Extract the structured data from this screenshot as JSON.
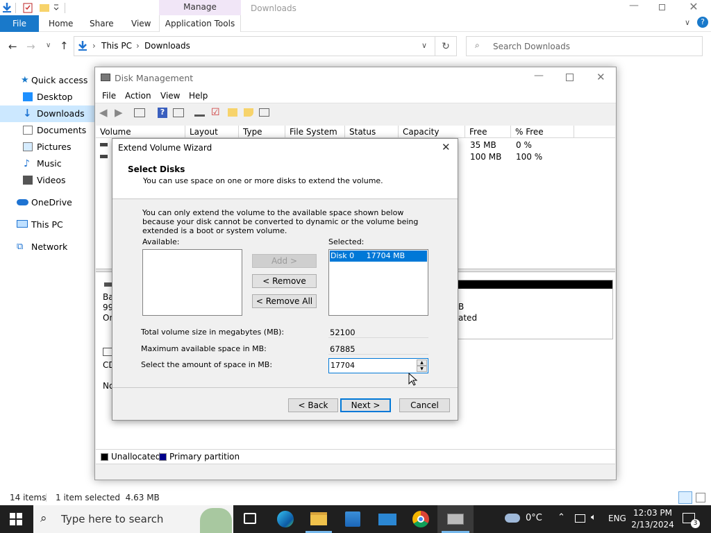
{
  "explorer": {
    "title_tab_manage": "Manage",
    "title_tab_downloads": "Downloads",
    "ribbon_tabs": [
      "File",
      "Home",
      "Share",
      "View",
      "Application Tools"
    ],
    "breadcrumb": [
      "This PC",
      "Downloads"
    ],
    "search_placeholder": "Search Downloads",
    "nav": [
      "Quick access",
      "Desktop",
      "Downloads",
      "Documents",
      "Pictures",
      "Music",
      "Videos",
      "OneDrive",
      "This PC",
      "Network"
    ],
    "status_items": "14 items",
    "status_selected": "1 item selected  4.63 MB"
  },
  "disk_mgmt": {
    "title": "Disk Management",
    "menu": [
      "File",
      "Action",
      "View",
      "Help"
    ],
    "columns": [
      "Volume",
      "Layout",
      "Type",
      "File System",
      "Status",
      "Capacity",
      "Free Spa...",
      "% Free"
    ],
    "rows": [
      {
        "free": "35 MB",
        "pct": "0 %"
      },
      {
        "free": "100 MB",
        "pct": "100 %"
      }
    ],
    "lower_left": [
      "Ba",
      "99.",
      "On",
      "CD",
      "No"
    ],
    "lower_right": [
      "B",
      "ated"
    ],
    "legend": [
      "Unallocated",
      "Primary partition"
    ],
    "legend_colors": [
      "#000000",
      "#00008b"
    ]
  },
  "wizard": {
    "title": "Extend Volume Wizard",
    "heading": "Select Disks",
    "subheading": "You can use space on one or more disks to extend the volume.",
    "notice": "You can only extend the volume to the available space shown below because your disk cannot be converted to dynamic or the volume being extended is a boot or system volume.",
    "available_label": "Available:",
    "selected_label": "Selected:",
    "selected_item": "Disk 0     17704 MB",
    "add_btn": "Add >",
    "remove_btn": "< Remove",
    "remove_all_btn": "< Remove All",
    "total_label": "Total volume size in megabytes (MB):",
    "total_value": "52100",
    "max_label": "Maximum available space in MB:",
    "max_value": "67885",
    "amount_label": "Select the amount of space in MB:",
    "amount_value": "17704",
    "back_btn": "< Back",
    "next_btn": "Next >",
    "cancel_btn": "Cancel"
  },
  "taskbar": {
    "search_placeholder": "Type here to search",
    "weather": "0°C",
    "lang": "ENG",
    "time": "12:03 PM",
    "date": "2/13/2024",
    "notif_count": "3"
  }
}
